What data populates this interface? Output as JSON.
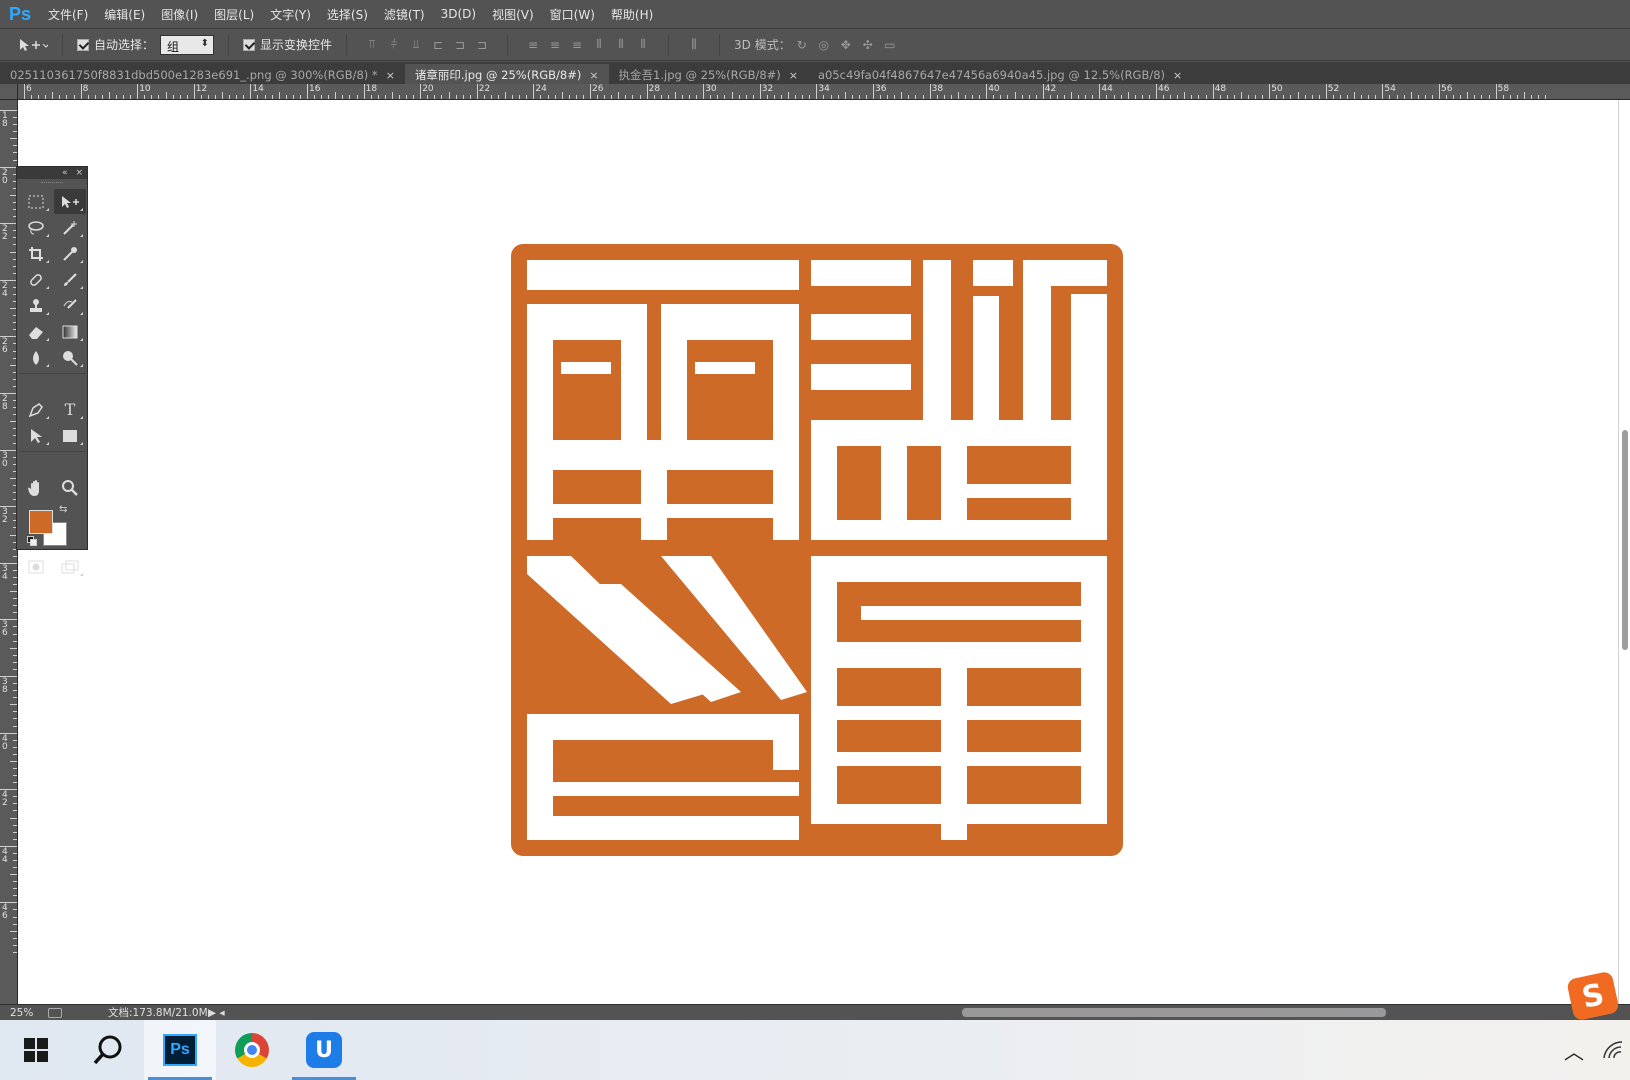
{
  "app": {
    "logo": "Ps",
    "menu": [
      "文件(F)",
      "编辑(E)",
      "图像(I)",
      "图层(L)",
      "文字(Y)",
      "选择(S)",
      "滤镜(T)",
      "3D(D)",
      "视图(V)",
      "窗口(W)",
      "帮助(H)"
    ]
  },
  "options": {
    "auto_select_label": "自动选择：",
    "auto_select_value": "组",
    "show_transform_label": "显示变换控件",
    "mode_3d_label": "3D 模式："
  },
  "tabs": [
    {
      "label": "025110361750f8831dbd500e1283e691_.png @ 300%(RGB/8) *",
      "active": false
    },
    {
      "label": "诸章丽印.jpg @ 25%(RGB/8#)",
      "active": true
    },
    {
      "label": "执金吾1.jpg @ 25%(RGB/8#)",
      "active": false
    },
    {
      "label": "a05c49fa04f4867647e47456a6940a45.jpg @ 12.5%(RGB/8)",
      "active": false
    }
  ],
  "ruler": {
    "h_labels": [
      "6",
      "8",
      "10",
      "12",
      "14",
      "16",
      "18",
      "20",
      "22",
      "24",
      "26",
      "28",
      "30",
      "32",
      "34",
      "36",
      "38",
      "40",
      "42",
      "44",
      "46",
      "48",
      "50",
      "52",
      "54",
      "56",
      "58"
    ],
    "v_labels": [
      "18",
      "20",
      "22",
      "24",
      "26",
      "28",
      "30",
      "32",
      "34",
      "36",
      "38",
      "40",
      "42",
      "44",
      "46"
    ]
  },
  "colors": {
    "foreground": "#cd6a28",
    "background": "#ffffff",
    "seal": "#cd6a28"
  },
  "tools": [
    "rect-marquee-icon",
    "move-icon",
    "lasso-icon",
    "magic-wand-icon",
    "crop-icon",
    "eyedropper-icon",
    "healing-brush-icon",
    "brush-icon",
    "clone-stamp-icon",
    "history-brush-icon",
    "eraser-icon",
    "gradient-icon",
    "blur-icon",
    "dodge-icon",
    "pen-icon",
    "type-icon",
    "path-select-icon",
    "rectangle-icon",
    "hand-icon",
    "zoom-icon"
  ],
  "status": {
    "zoom": "25%",
    "doc_info": "文档:173.8M/21.0M"
  },
  "taskbar": {
    "ps_label": "Ps",
    "ime_label": "S"
  }
}
